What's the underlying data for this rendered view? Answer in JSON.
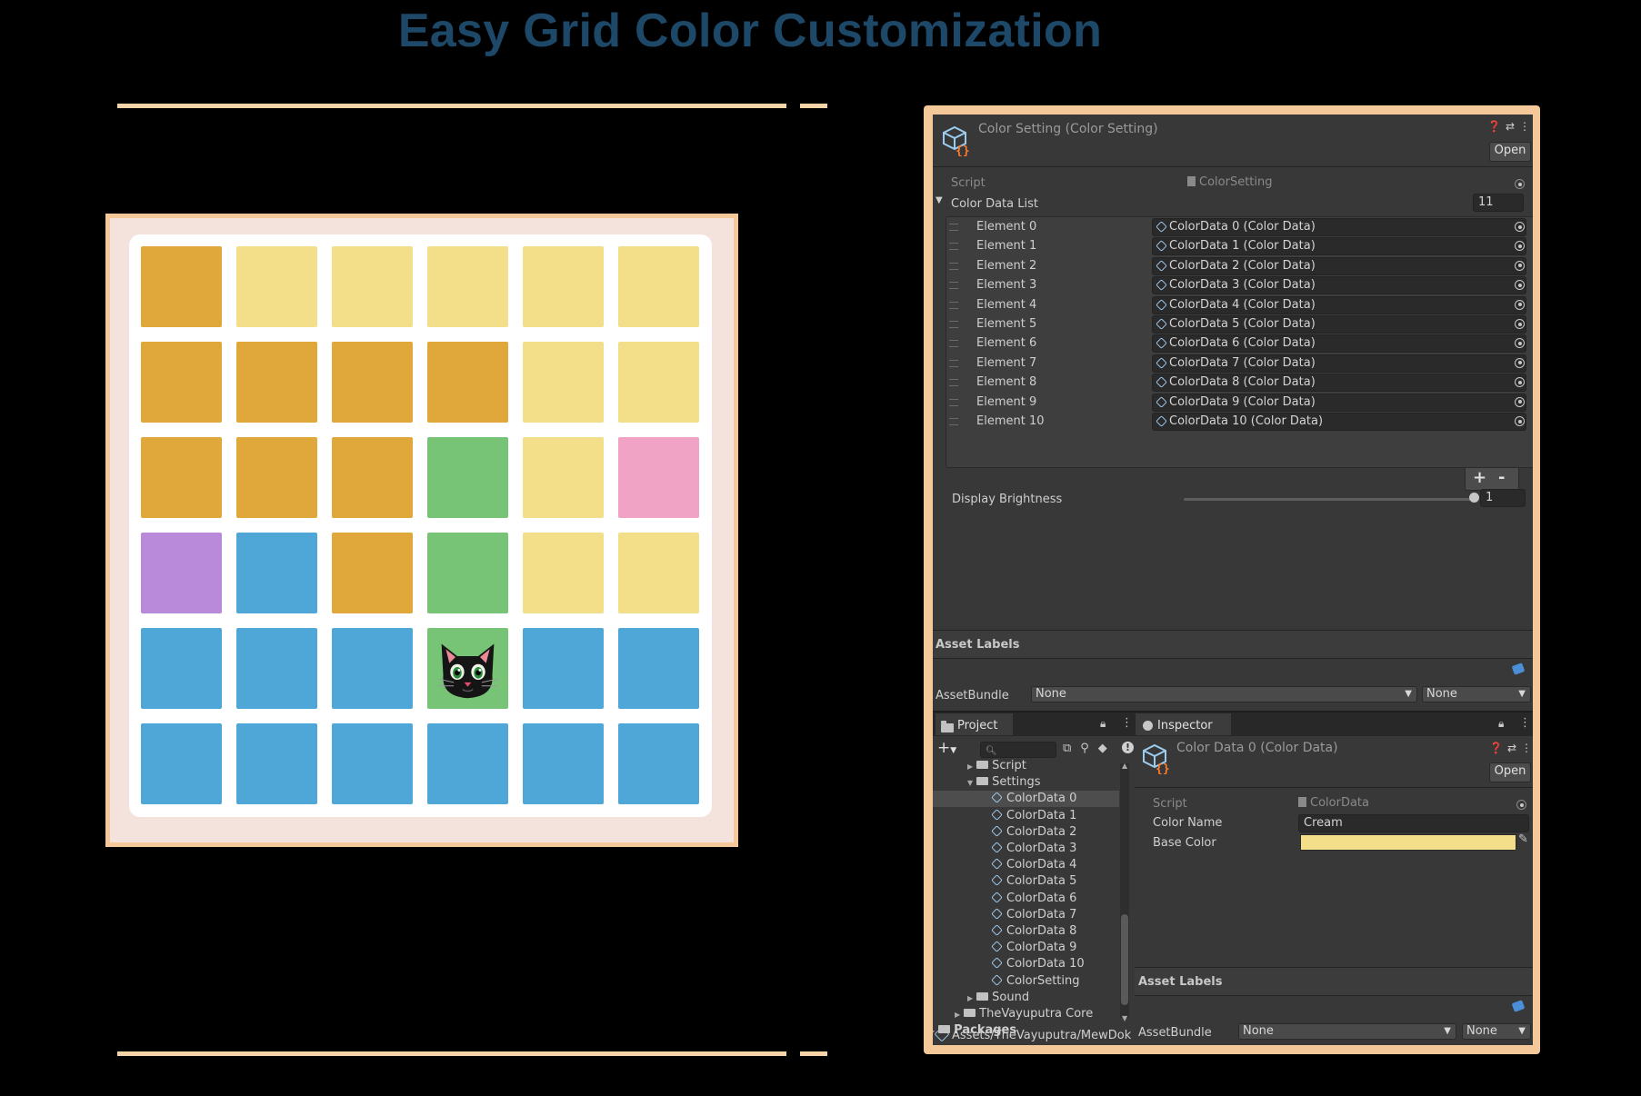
{
  "header": {
    "title": "Easy Grid Color Customization"
  },
  "colors": {
    "orange": "#e0a73a",
    "cream": "#f3df89",
    "green": "#78c477",
    "pink": "#f0a3c5",
    "purple": "#b98ad9",
    "blue": "#4fa7d8",
    "title": "#1d4867",
    "frame": "#f5c89a"
  },
  "grid": {
    "rows": [
      [
        "orange",
        "cream",
        "cream",
        "cream",
        "cream",
        "cream"
      ],
      [
        "orange",
        "orange",
        "orange",
        "orange",
        "cream",
        "cream"
      ],
      [
        "orange",
        "orange",
        "orange",
        "green",
        "cream",
        "pink"
      ],
      [
        "purple",
        "blue",
        "orange",
        "green",
        "cream",
        "cream"
      ],
      [
        "blue",
        "blue",
        "blue",
        "cat",
        "blue",
        "blue"
      ],
      [
        "blue",
        "blue",
        "blue",
        "blue",
        "blue",
        "blue"
      ]
    ],
    "cat_cell_color": "green",
    "cat_icon": "black-cat-icon"
  },
  "inspector_top": {
    "title": "Color Setting (Color Setting)",
    "open_button": "Open",
    "script_label": "Script",
    "script_value": "ColorSetting",
    "list_label": "Color Data List",
    "list_count": "11",
    "elements": [
      {
        "label": "Element 0",
        "value": "ColorData 0 (Color Data)"
      },
      {
        "label": "Element 1",
        "value": "ColorData 1 (Color Data)"
      },
      {
        "label": "Element 2",
        "value": "ColorData 2 (Color Data)"
      },
      {
        "label": "Element 3",
        "value": "ColorData 3 (Color Data)"
      },
      {
        "label": "Element 4",
        "value": "ColorData 4 (Color Data)"
      },
      {
        "label": "Element 5",
        "value": "ColorData 5 (Color Data)"
      },
      {
        "label": "Element 6",
        "value": "ColorData 6 (Color Data)"
      },
      {
        "label": "Element 7",
        "value": "ColorData 7 (Color Data)"
      },
      {
        "label": "Element 8",
        "value": "ColorData 8 (Color Data)"
      },
      {
        "label": "Element 9",
        "value": "ColorData 9 (Color Data)"
      },
      {
        "label": "Element 10",
        "value": "ColorData 10 (Color Data)"
      }
    ],
    "add_button": "+",
    "remove_button": "-",
    "brightness_label": "Display Brightness",
    "brightness_value": "1",
    "brightness_fraction": 1.0,
    "asset_labels": "Asset Labels",
    "assetbundle_label": "AssetBundle",
    "assetbundle_value": "None",
    "variant_value": "None"
  },
  "project": {
    "tab_label": "Project",
    "add_label": "+",
    "tree": [
      {
        "label": "Script",
        "indent": 3,
        "type": "folder"
      },
      {
        "label": "Settings",
        "indent": 3,
        "type": "folder-open"
      },
      {
        "label": "ColorData 0",
        "indent": 4,
        "type": "asset",
        "selected": true
      },
      {
        "label": "ColorData 1",
        "indent": 4,
        "type": "asset"
      },
      {
        "label": "ColorData 2",
        "indent": 4,
        "type": "asset"
      },
      {
        "label": "ColorData 3",
        "indent": 4,
        "type": "asset"
      },
      {
        "label": "ColorData 4",
        "indent": 4,
        "type": "asset"
      },
      {
        "label": "ColorData 5",
        "indent": 4,
        "type": "asset"
      },
      {
        "label": "ColorData 6",
        "indent": 4,
        "type": "asset"
      },
      {
        "label": "ColorData 7",
        "indent": 4,
        "type": "asset"
      },
      {
        "label": "ColorData 8",
        "indent": 4,
        "type": "asset"
      },
      {
        "label": "ColorData 9",
        "indent": 4,
        "type": "asset"
      },
      {
        "label": "ColorData 10",
        "indent": 4,
        "type": "asset"
      },
      {
        "label": "ColorSetting",
        "indent": 4,
        "type": "asset"
      },
      {
        "label": "Sound",
        "indent": 3,
        "type": "folder-closed"
      },
      {
        "label": "TheVayuputra Core",
        "indent": 2,
        "type": "folder-closed"
      },
      {
        "label": "Packages",
        "indent": 0,
        "type": "folder-closed",
        "bold": true
      }
    ],
    "path": "Assets/TheVayuputra/MewDok"
  },
  "inspector_bottom": {
    "tab_label": "Inspector",
    "title": "Color Data 0 (Color Data)",
    "open_button": "Open",
    "script_label": "Script",
    "script_value": "ColorData",
    "name_label": "Color Name",
    "name_value": "Cream",
    "base_color_label": "Base Color",
    "base_color_value": "#f3df89",
    "asset_labels": "Asset Labels",
    "assetbundle_label": "AssetBundle",
    "assetbundle_value": "None",
    "variant_value": "None"
  }
}
